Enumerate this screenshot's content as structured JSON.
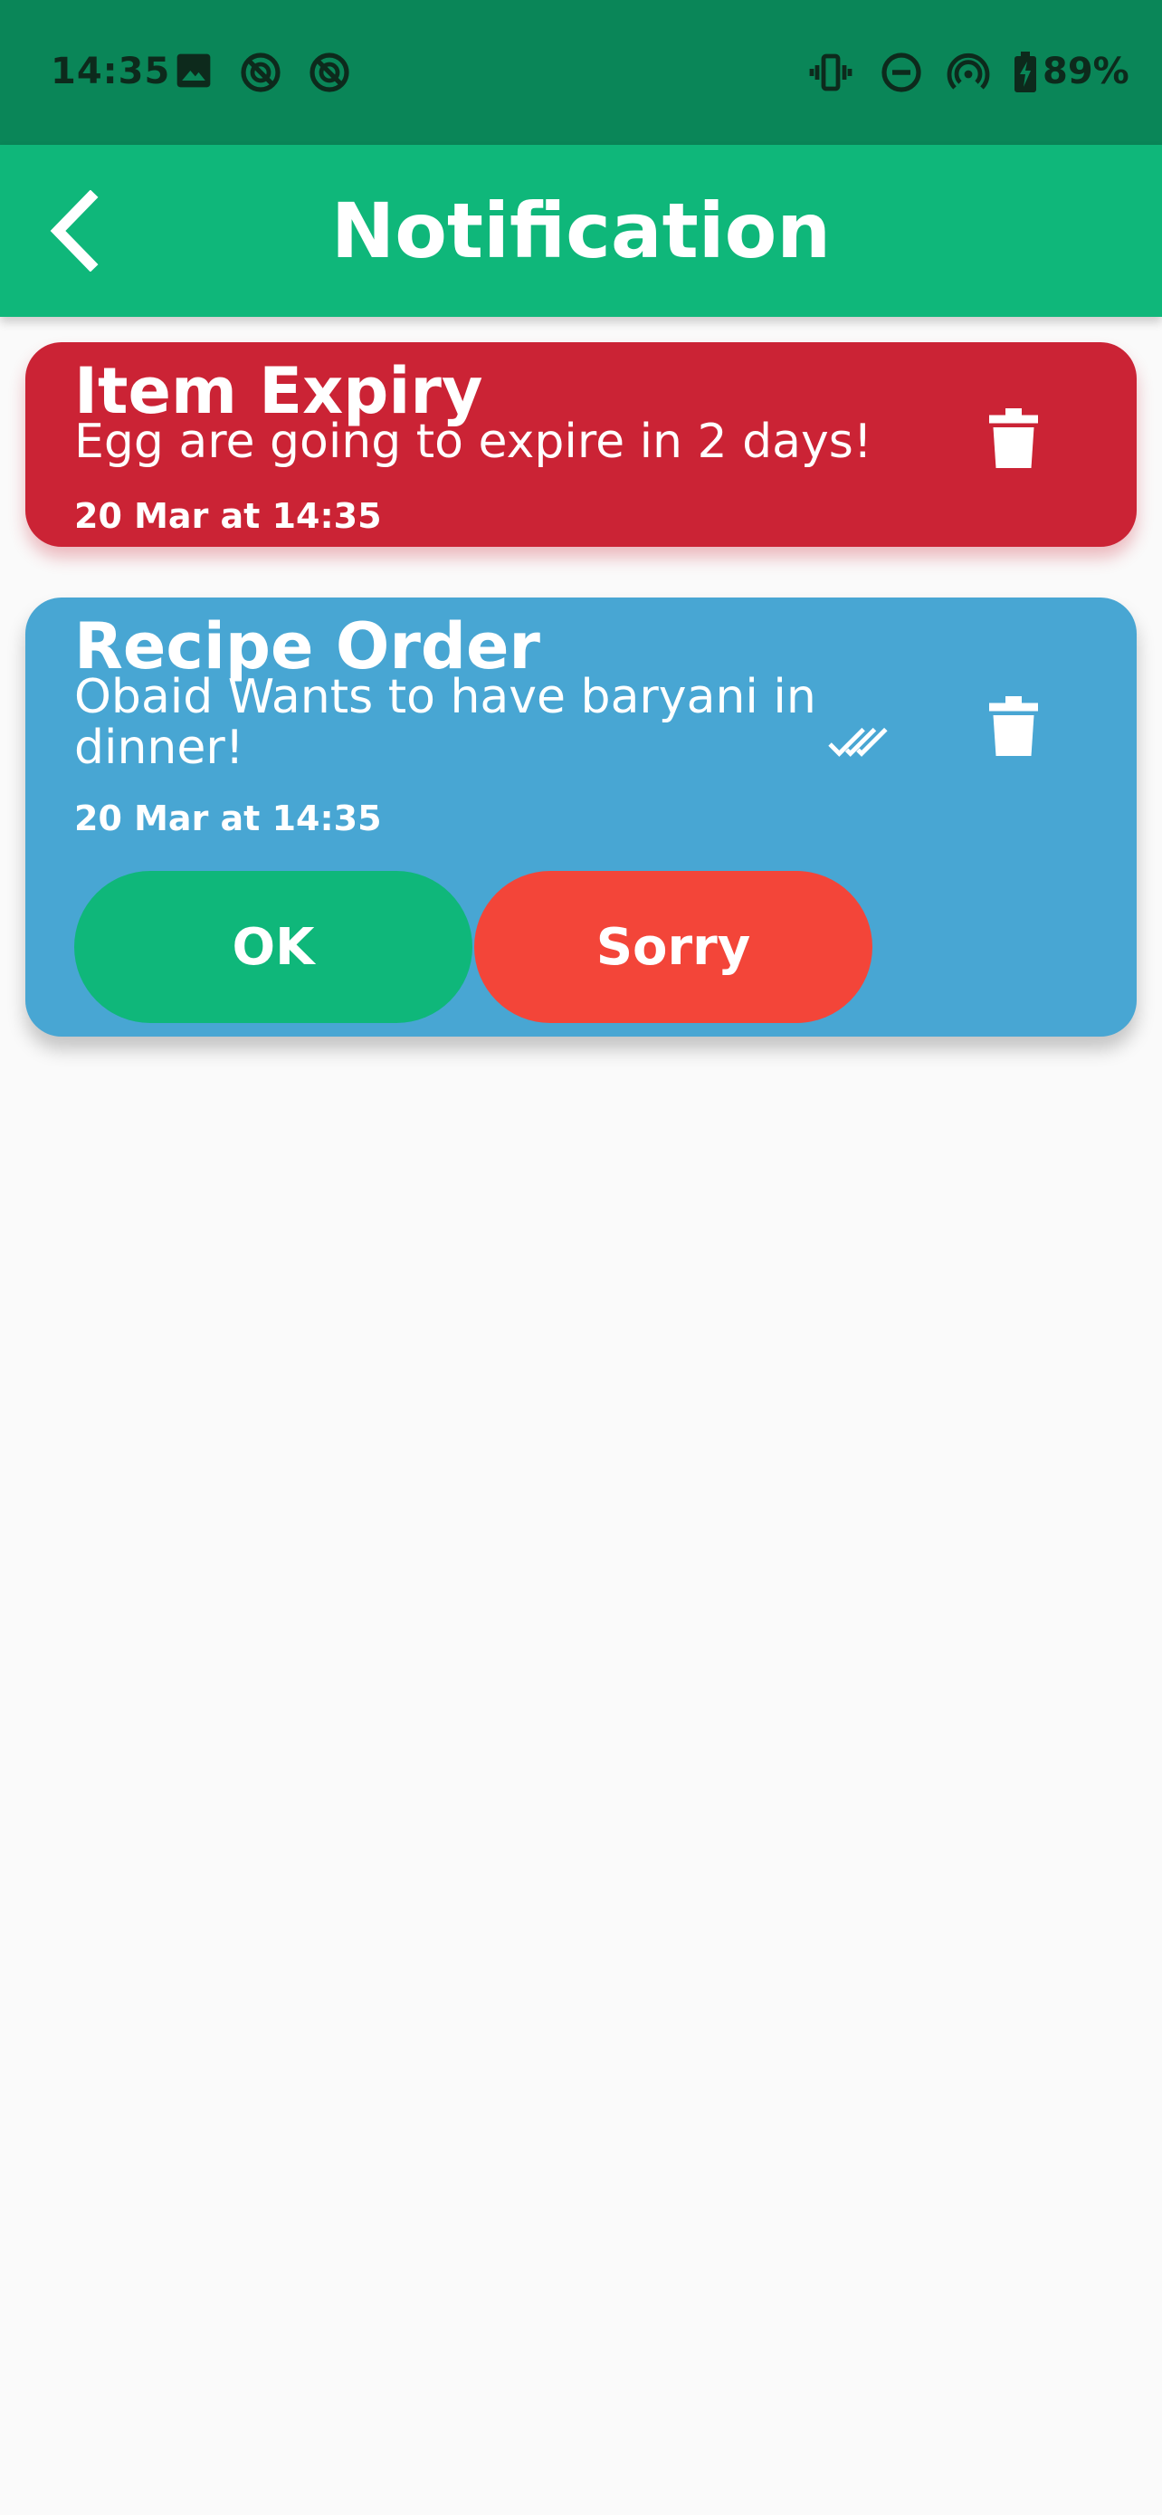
{
  "status_bar": {
    "time": "14:35",
    "battery_text": "89%",
    "icons": [
      "image-icon",
      "sync-off-icon",
      "sync-off-icon",
      "vibrate-icon",
      "do-not-disturb-icon",
      "hotspot-icon",
      "battery-charging-icon"
    ]
  },
  "app_bar": {
    "title": "Notification",
    "back_icon": "chevron-left-icon"
  },
  "notifications": [
    {
      "title": "Item Expiry",
      "message": "Egg are going to expire in 2 days!",
      "time": "20 Mar at 14:35",
      "color": "#cb2335",
      "actions_icons": [
        "trash-icon"
      ]
    },
    {
      "title": "Recipe Order",
      "message": "Obaid Wants to have baryani in dinner!",
      "time": "20 Mar at 14:35",
      "color": "#48a6d3",
      "actions_icons": [
        "double-check-icon",
        "trash-icon"
      ],
      "buttons": {
        "ok": "OK",
        "sorry": "Sorry"
      }
    }
  ],
  "colors": {
    "status_bar": "#0a8658",
    "app_bar": "#0fb77a",
    "ok_button": "#0fb77a",
    "sorry_button": "#f34539",
    "background": "#fafafa"
  }
}
